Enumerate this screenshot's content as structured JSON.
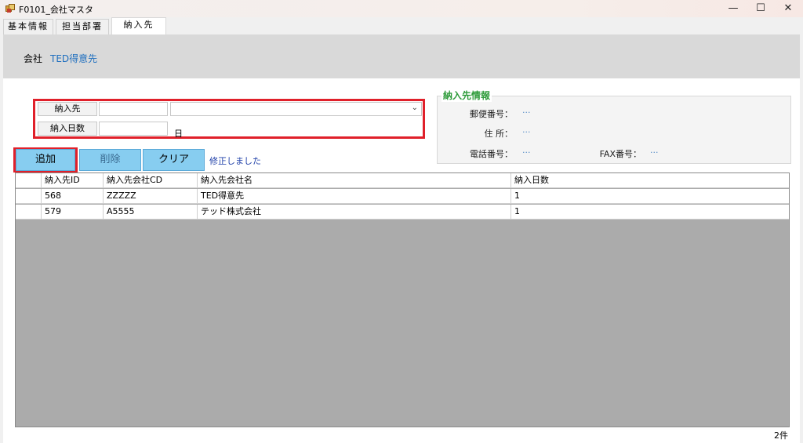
{
  "window": {
    "title": "F0101_会社マスタ",
    "minimize_glyph": "—",
    "maximize_glyph": "☐",
    "close_glyph": "✕"
  },
  "tabs": [
    {
      "label": "基本情報"
    },
    {
      "label": "担当部署"
    },
    {
      "label": "納入先",
      "active": true
    }
  ],
  "company": {
    "label": "会社",
    "value": "TED得意先"
  },
  "form": {
    "delivery_label": "納入先",
    "delivery_code": "",
    "delivery_name": "",
    "delivery_days_label": "納入日数",
    "delivery_days": "",
    "day_unit": "日"
  },
  "info": {
    "title": "納入先情報",
    "postal_label": "郵便番号：",
    "postal_value": "···",
    "address_label": "住 所：",
    "address_value": "···",
    "phone_label": "電話番号：",
    "phone_value": "···",
    "fax_label": "FAX番号：",
    "fax_value": "···"
  },
  "actions": {
    "add": "追加",
    "delete": "削除",
    "clear": "クリア",
    "message": "修正しました"
  },
  "table": {
    "columns": [
      "納入先ID",
      "納入先会社CD",
      "納入先会社名",
      "納入日数"
    ],
    "rows": [
      [
        "568",
        "ZZZZZ",
        "TED得意先",
        "1"
      ],
      [
        "579",
        "A5555",
        "テッド株式会社",
        "1"
      ]
    ]
  },
  "status": {
    "count": "2件"
  },
  "colors": {
    "highlight_border": "#e0202a",
    "button_fill": "#87cdf0",
    "group_title": "#2e9b3a",
    "link_text": "#1f6fbf"
  }
}
